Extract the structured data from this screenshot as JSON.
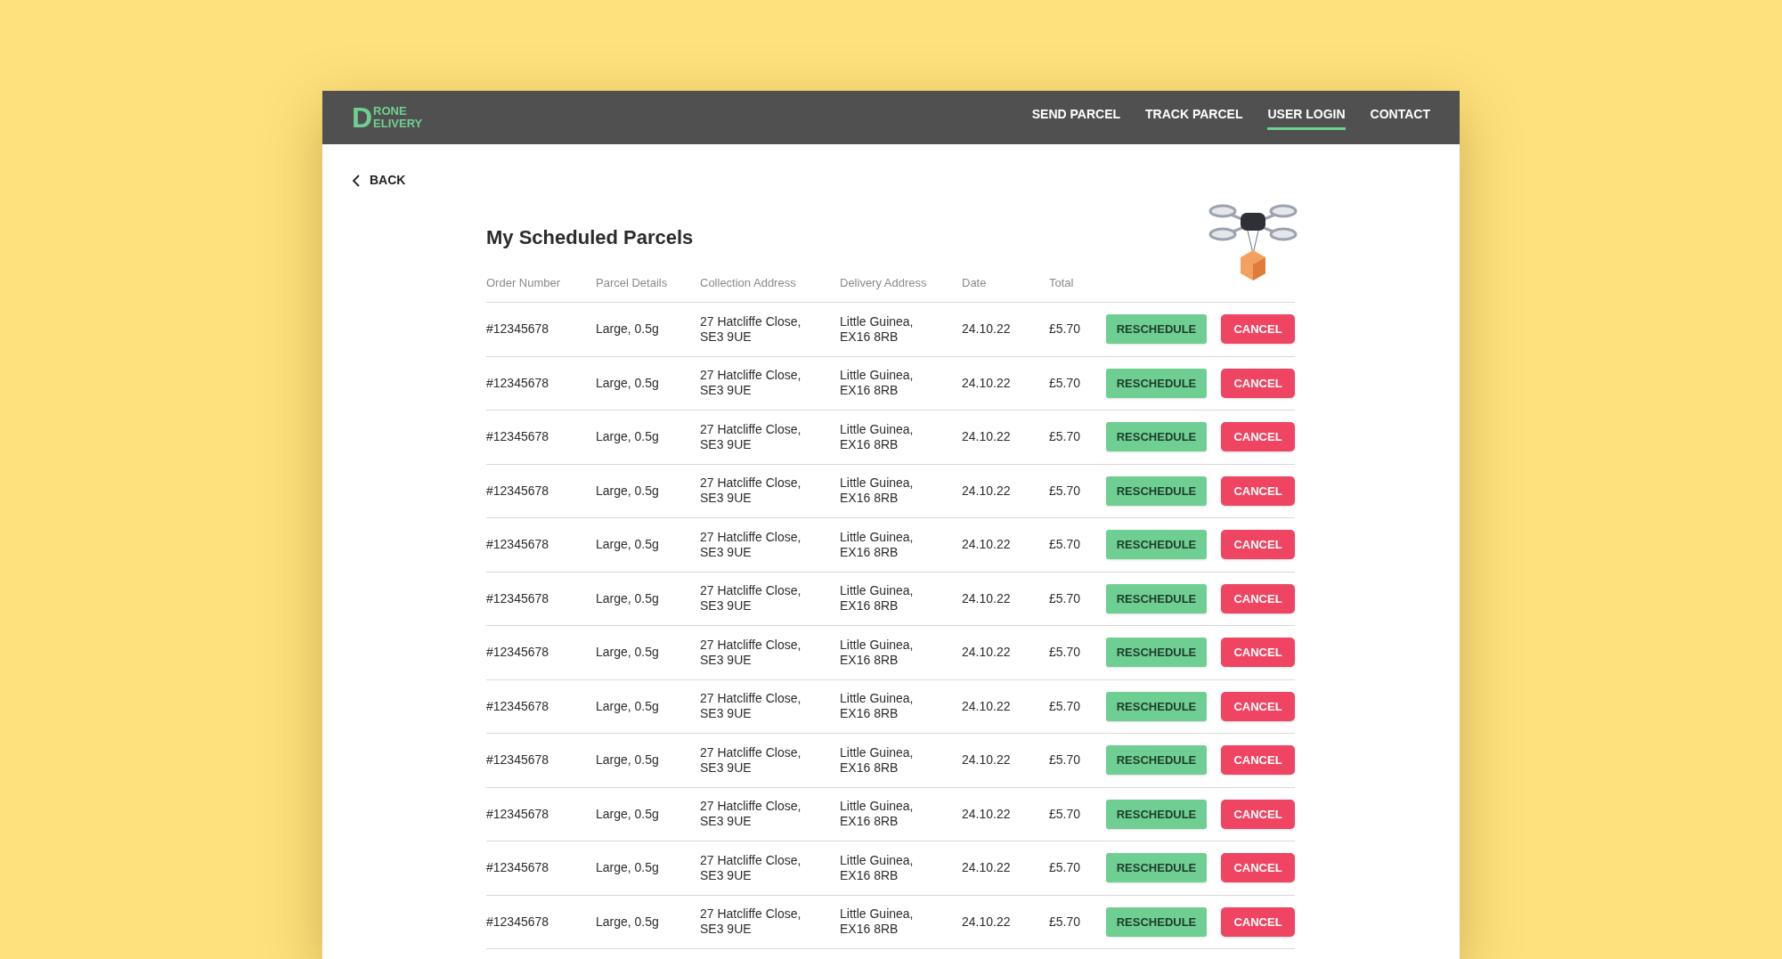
{
  "logo": {
    "letter": "D",
    "line_1": "RONE",
    "line_2": "ELIVERY"
  },
  "nav": [
    {
      "label": "SEND PARCEL",
      "selected": false
    },
    {
      "label": "TRACK PARCEL",
      "selected": false
    },
    {
      "label": "USER LOGIN",
      "selected": true
    },
    {
      "label": "CONTACT",
      "selected": false
    }
  ],
  "back": {
    "label": "BACK"
  },
  "title": "My Scheduled Parcels",
  "table": {
    "columns": [
      "Order Number",
      "Parcel Details",
      "Collection Address",
      "Delivery Address",
      "Date",
      "Total"
    ],
    "rows": [
      {
        "order": "#12345678",
        "details": "Large, 0.5g",
        "collection": [
          "27 Hatcliffe Close,",
          "SE3 9UE"
        ],
        "delivery": [
          "Little Guinea,",
          "EX16 8RB"
        ],
        "date": "24.10.22",
        "total": "£5.70",
        "reschedule": "RESCHEDULE",
        "cancel": "CANCEL"
      },
      {
        "order": "#12345678",
        "details": "Large, 0.5g",
        "collection": [
          "27 Hatcliffe Close,",
          "SE3 9UE"
        ],
        "delivery": [
          "Little Guinea,",
          "EX16 8RB"
        ],
        "date": "24.10.22",
        "total": "£5.70",
        "reschedule": "RESCHEDULE",
        "cancel": "CANCEL"
      },
      {
        "order": "#12345678",
        "details": "Large, 0.5g",
        "collection": [
          "27 Hatcliffe Close,",
          "SE3 9UE"
        ],
        "delivery": [
          "Little Guinea,",
          "EX16 8RB"
        ],
        "date": "24.10.22",
        "total": "£5.70",
        "reschedule": "RESCHEDULE",
        "cancel": "CANCEL"
      },
      {
        "order": "#12345678",
        "details": "Large, 0.5g",
        "collection": [
          "27 Hatcliffe Close,",
          "SE3 9UE"
        ],
        "delivery": [
          "Little Guinea,",
          "EX16 8RB"
        ],
        "date": "24.10.22",
        "total": "£5.70",
        "reschedule": "RESCHEDULE",
        "cancel": "CANCEL"
      },
      {
        "order": "#12345678",
        "details": "Large, 0.5g",
        "collection": [
          "27 Hatcliffe Close,",
          "SE3 9UE"
        ],
        "delivery": [
          "Little Guinea,",
          "EX16 8RB"
        ],
        "date": "24.10.22",
        "total": "£5.70",
        "reschedule": "RESCHEDULE",
        "cancel": "CANCEL"
      },
      {
        "order": "#12345678",
        "details": "Large, 0.5g",
        "collection": [
          "27 Hatcliffe Close,",
          "SE3 9UE"
        ],
        "delivery": [
          "Little Guinea,",
          "EX16 8RB"
        ],
        "date": "24.10.22",
        "total": "£5.70",
        "reschedule": "RESCHEDULE",
        "cancel": "CANCEL"
      },
      {
        "order": "#12345678",
        "details": "Large, 0.5g",
        "collection": [
          "27 Hatcliffe Close,",
          "SE3 9UE"
        ],
        "delivery": [
          "Little Guinea,",
          "EX16 8RB"
        ],
        "date": "24.10.22",
        "total": "£5.70",
        "reschedule": "RESCHEDULE",
        "cancel": "CANCEL"
      },
      {
        "order": "#12345678",
        "details": "Large, 0.5g",
        "collection": [
          "27 Hatcliffe Close,",
          "SE3 9UE"
        ],
        "delivery": [
          "Little Guinea,",
          "EX16 8RB"
        ],
        "date": "24.10.22",
        "total": "£5.70",
        "reschedule": "RESCHEDULE",
        "cancel": "CANCEL"
      },
      {
        "order": "#12345678",
        "details": "Large, 0.5g",
        "collection": [
          "27 Hatcliffe Close,",
          "SE3 9UE"
        ],
        "delivery": [
          "Little Guinea,",
          "EX16 8RB"
        ],
        "date": "24.10.22",
        "total": "£5.70",
        "reschedule": "RESCHEDULE",
        "cancel": "CANCEL"
      },
      {
        "order": "#12345678",
        "details": "Large, 0.5g",
        "collection": [
          "27 Hatcliffe Close,",
          "SE3 9UE"
        ],
        "delivery": [
          "Little Guinea,",
          "EX16 8RB"
        ],
        "date": "24.10.22",
        "total": "£5.70",
        "reschedule": "RESCHEDULE",
        "cancel": "CANCEL"
      },
      {
        "order": "#12345678",
        "details": "Large, 0.5g",
        "collection": [
          "27 Hatcliffe Close,",
          "SE3 9UE"
        ],
        "delivery": [
          "Little Guinea,",
          "EX16 8RB"
        ],
        "date": "24.10.22",
        "total": "£5.70",
        "reschedule": "RESCHEDULE",
        "cancel": "CANCEL"
      },
      {
        "order": "#12345678",
        "details": "Large, 0.5g",
        "collection": [
          "27 Hatcliffe Close,",
          "SE3 9UE"
        ],
        "delivery": [
          "Little Guinea,",
          "EX16 8RB"
        ],
        "date": "24.10.22",
        "total": "£5.70",
        "reschedule": "RESCHEDULE",
        "cancel": "CANCEL"
      }
    ]
  }
}
